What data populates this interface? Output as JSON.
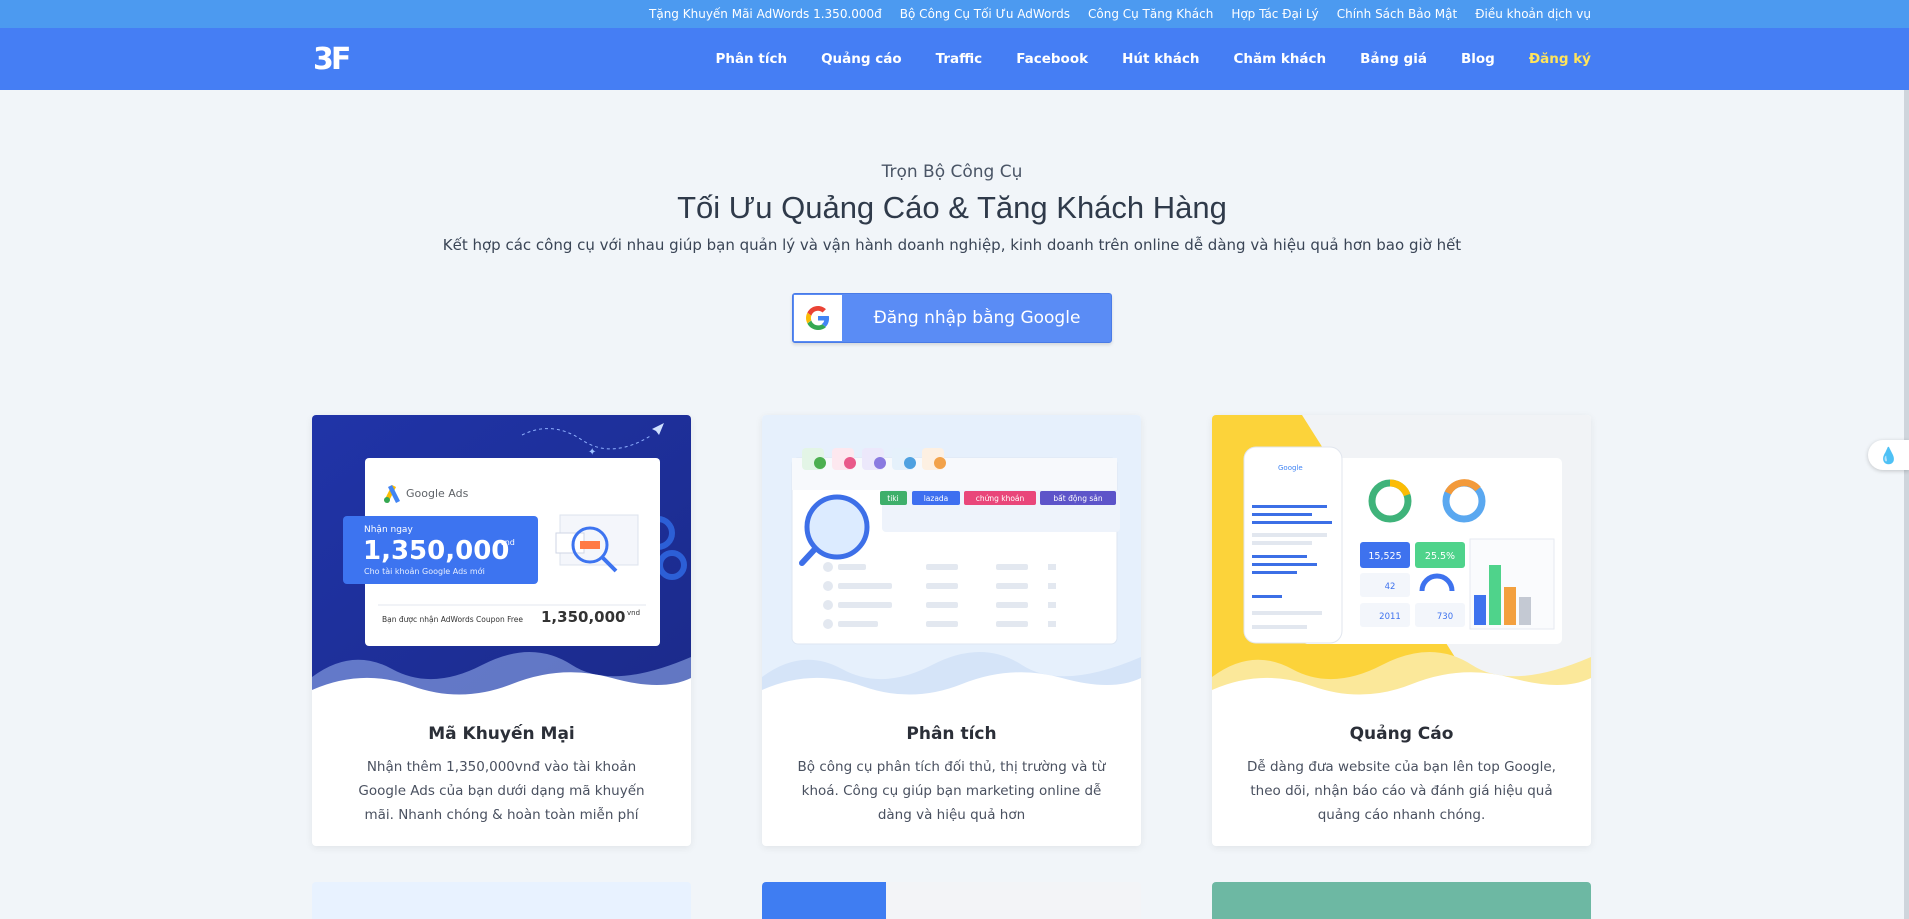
{
  "topbar": {
    "links": [
      "Tặng Khuyến Mãi AdWords 1.350.000đ",
      "Bộ Công Cụ Tối Ưu AdWords",
      "Công Cụ Tăng Khách",
      "Hợp Tác Đại Lý",
      "Chính Sách Bảo Mật",
      "Điều khoản dịch vụ"
    ]
  },
  "navbar": {
    "logo": "3F",
    "links": [
      "Phân tích",
      "Quảng cáo",
      "Traffic",
      "Facebook",
      "Hút khách",
      "Chăm khách",
      "Bảng giá",
      "Blog"
    ],
    "signup": "Đăng ký"
  },
  "hero": {
    "kicker": "Trọn Bộ Công Cụ",
    "title": "Tối Ưu Quảng Cáo & Tăng Khách Hàng",
    "subtitle": "Kết hợp các công cụ với nhau giúp bạn quản lý và vận hành doanh nghiệp, kinh doanh trên online dễ dàng và hiệu quả hơn bao giờ hết",
    "google_button": "Đăng nhập bằng Google"
  },
  "cards": [
    {
      "title": "Mã Khuyến Mại",
      "desc": "Nhận thêm 1,350,000vnđ vào tài khoản Google Ads của bạn dưới dạng mã khuyến mãi. Nhanh chóng & hoàn toàn miễn phí",
      "art": {
        "brand": "Google Ads",
        "promo_kicker": "Nhận ngay",
        "promo_amount": "1,350,000",
        "promo_unit": "vnd",
        "promo_caption": "Cho tài khoản Google Ads mới",
        "footer_label": "Bạn được nhận AdWords Coupon Free",
        "footer_amount": "1,350,000",
        "footer_unit": "vnd"
      }
    },
    {
      "title": "Phân tích",
      "desc": "Bộ công cụ phân tích đối thủ, thị trường và từ khoá. Công cụ giúp bạn marketing online dễ dàng và hiệu quả hơn",
      "art": {
        "tags": [
          "tiki",
          "lazada",
          "chứng khoán",
          "bất động sản"
        ]
      }
    },
    {
      "title": "Quảng Cáo",
      "desc": "Dễ dàng đưa website của bạn lên top Google, theo dõi, nhận báo cáo và đánh giá hiệu quả quảng cáo nhanh chóng.",
      "art": {
        "brand": "Google",
        "stat_a": "15,525",
        "stat_b": "25.5%",
        "stat_c": "42",
        "stat_d": "2011",
        "stat_e": "730"
      }
    }
  ],
  "colors": {
    "topbar": "#4c9af0",
    "navbar": "#457ef4",
    "signup": "#ffe45c",
    "page_bg": "#f1f5f9",
    "google_button": "#5a8cf5"
  }
}
